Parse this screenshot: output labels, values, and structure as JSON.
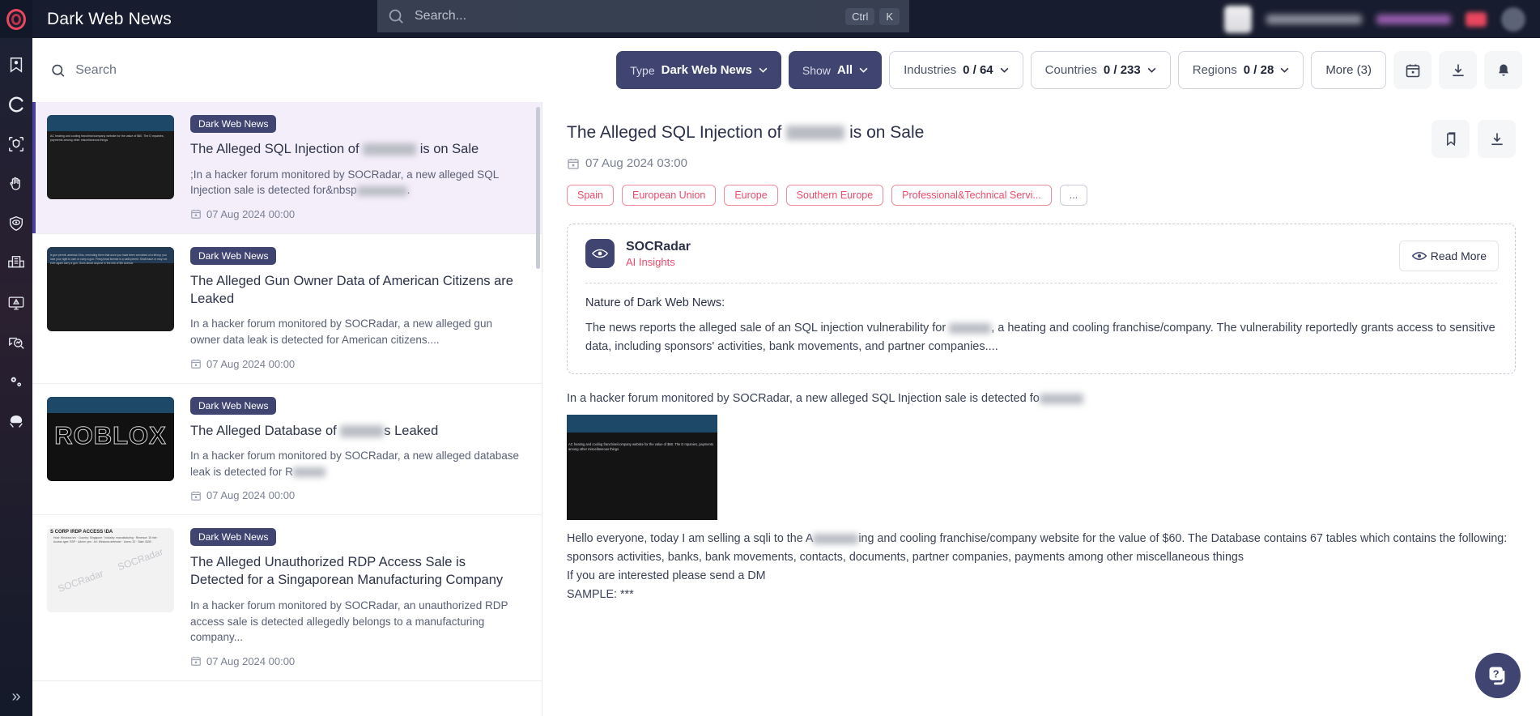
{
  "topbar": {
    "title": "Dark Web News",
    "search_placeholder": "Search...",
    "kbd_ctrl": "Ctrl",
    "kbd_k": "K",
    "logo_icon": "socradar-ring-logo",
    "search_icon": "search-icon"
  },
  "sidebar": {
    "items": [
      {
        "name": "bookmark-star",
        "label": "Bookmarks"
      },
      {
        "name": "cyber-threat-intel",
        "label": "Cyber Threat Intelligence"
      },
      {
        "name": "attack-surface",
        "label": "Attack Surface Management"
      },
      {
        "name": "digital-risk",
        "label": "Digital Risk Protection"
      },
      {
        "name": "brand-protection",
        "label": "Brand Protection"
      },
      {
        "name": "supply-chain",
        "label": "Supply Chain Intelligence"
      },
      {
        "name": "vulnerability-intel",
        "label": "Vulnerability Intelligence"
      },
      {
        "name": "threat-hunting",
        "label": "Threat Hunting"
      },
      {
        "name": "settings",
        "label": "Settings"
      },
      {
        "name": "dark-web",
        "label": "Dark Web Monitoring"
      }
    ],
    "expand_label": "Expand"
  },
  "filterbar": {
    "search_placeholder": "Search",
    "search_value": "",
    "chips": [
      {
        "key": "Type",
        "value": "Dark Web News",
        "style": "solid"
      },
      {
        "key": "Show",
        "value": "All",
        "style": "solid"
      },
      {
        "key": "Industries",
        "value": "0 / 64",
        "style": "outline"
      },
      {
        "key": "Countries",
        "value": "0 / 233",
        "style": "outline"
      },
      {
        "key": "Regions",
        "value": "0 / 28",
        "style": "outline"
      }
    ],
    "more_label": "More (3)",
    "icons": [
      "calendar-icon",
      "download-icon",
      "bell-icon"
    ]
  },
  "news_list": [
    {
      "badge": "Dark Web News",
      "title_pre": "The Alleged SQL Injection of ",
      "title_post": " is on Sale",
      "redacted_width": 66,
      "desc_pre": ";In a hacker forum monitored by SOCRadar, a new alleged SQL Injection sale is detected for&nbsp",
      "desc_post": ".",
      "desc_redacted_width": 62,
      "date": "07 Aug 2024 00:00",
      "thumb_text": "AC heating and cooling franchise/company website for the value of $60. The D mpanies, payments among other miscellaneous things",
      "selected": true
    },
    {
      "badge": "Dark Web News",
      "title_pre": "The Alleged Gun Owner Data of American Citizens are Leaked",
      "title_post": "",
      "redacted_width": 0,
      "desc_pre": "In a hacker forum monitored by SOCRadar, a new alleged gun owner data leak is detected for American citizens....",
      "desc_post": "",
      "desc_redacted_width": 0,
      "date": "07 Aug 2024 00:00",
      "thumb_text": "is gun permit. america Ohio, reminding them that once you have been convicted of a felony, you lose your right to own or carry a gun. Firing head license is a valid permit. Shall issue or may not ever again carry a gun. Guns about anyone in the risk of 5th Avenue.",
      "selected": false
    },
    {
      "badge": "Dark Web News",
      "title_pre": "The Alleged Database of ",
      "title_post": "s Leaked",
      "redacted_width": 54,
      "desc_pre": "In a hacker forum monitored by SOCRadar, a new alleged database leak is detected for R",
      "desc_post": "",
      "desc_redacted_width": 40,
      "date": "07 Aug 2024 00:00",
      "thumb_text": "ROBLOX",
      "selected": false
    },
    {
      "badge": "Dark Web News",
      "title_pre": "The Alleged Unauthorized RDP Access Sale is Detected for a Singaporean Manufacturing Company",
      "title_post": "",
      "redacted_width": 0,
      "desc_pre": "In a hacker forum monitored by SOCRadar, an unauthorized RDP access sale is detected allegedly belongs to a manufacturing company...",
      "desc_post": "",
      "desc_redacted_width": 0,
      "date": "07 Aug 2024 00:00",
      "thumb_text": "S CORP \\RDP ACCESS \\DA",
      "selected": false
    }
  ],
  "detail": {
    "title_pre": "The Alleged SQL Injection of ",
    "title_post": " is on Sale",
    "title_redacted_width": 72,
    "date": "07 Aug 2024 03:00",
    "tags": [
      "Spain",
      "European Union",
      "Europe",
      "Southern Europe",
      "Professional&Technical Servi...",
      "..."
    ],
    "actions": [
      "bookmark-icon",
      "download-icon"
    ],
    "ai_card": {
      "brand": "SOCRadar",
      "subtitle": "AI Insights",
      "read_more": "Read More",
      "heading": "Nature of Dark Web News:",
      "paragraph_pre": "The news reports the alleged sale of an SQL injection vulnerability for ",
      "paragraph_post": ", a heating and cooling franchise/company. The vulnerability reportedly grants access to sensitive data, including sponsors' activities, bank movements, and partner companies....",
      "paragraph_redacted_width": 52,
      "logo_icon": "socradar-eye-icon"
    },
    "lead_pre": "In a hacker forum monitored by SOCRadar, a new alleged SQL Injection sale is detected fo",
    "lead_redacted_width": 54,
    "screenshot_text": "AC heating and cooling franchise/company website for the value of $60. The D mpanies, payments among other miscellaneous things",
    "body_line1_pre": "Hello everyone, today I am selling a sqli to the A",
    "body_line1_post": "ing and cooling franchise/company website for the value of $60. The Database contains 67 tables which contains the following: sponsors activities, banks, bank movements, contacts, documents, partner companies, payments among other miscellaneous things",
    "body_line1_redacted_width": 56,
    "body_line2": "If you are interested please send a DM",
    "body_line3": "SAMPLE: ***"
  },
  "help_button": {
    "icon": "help-chat-icon",
    "label": "Help"
  },
  "colors": {
    "topbar_bg": "#171c2e",
    "accent_purple": "#3f4470",
    "selected_row": "#f4eefb",
    "tag_red": "#ef4a6b",
    "logo_red": "#e8475f"
  }
}
